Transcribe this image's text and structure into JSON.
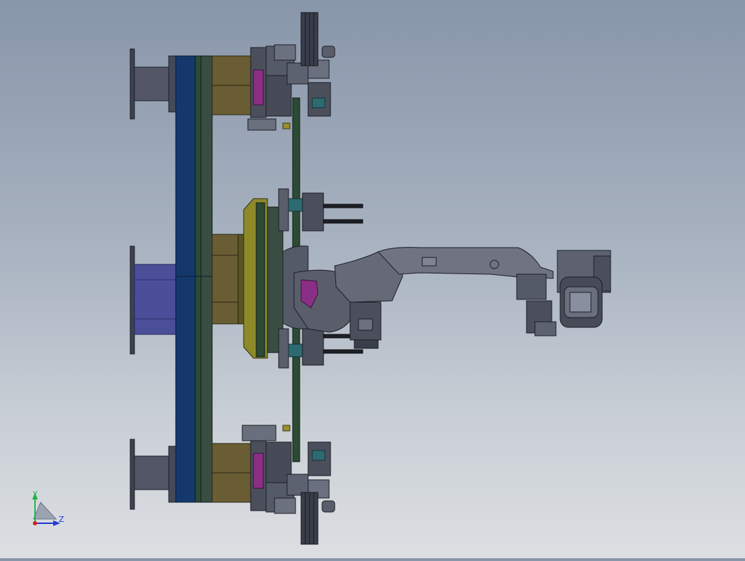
{
  "triad": {
    "y_label": "Y",
    "z_label": "Z",
    "y_color": "#21b34a",
    "z_color": "#2336d6",
    "origin_color": "#d11f1f"
  },
  "colors": {
    "steel": "#4b4f5c",
    "steel_dark": "#2d303a",
    "steel_light": "#7a7f8f",
    "navy_plate": "#14386b",
    "indigo": "#4b4f9a",
    "olive": "#6a5d33",
    "olive_bright": "#8e8a2a",
    "green_dark": "#2c4b35",
    "teal": "#2e6b70",
    "magenta": "#8b2f86",
    "robot_body": "#5a5e6a"
  }
}
